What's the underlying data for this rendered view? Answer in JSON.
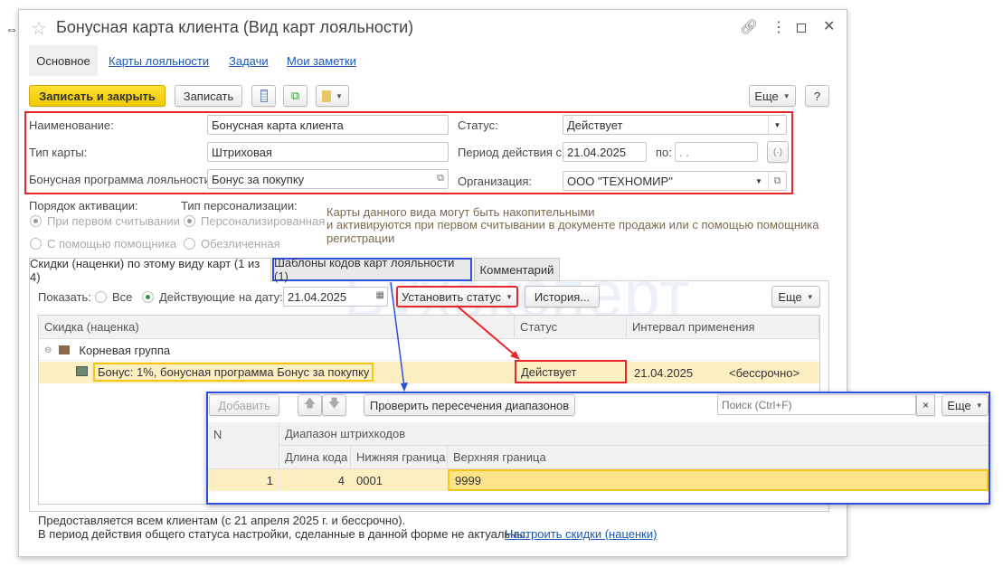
{
  "window": {
    "title": "Бонусная карта клиента (Вид карт лояльности)"
  },
  "nav": {
    "tabs": [
      {
        "label": "Основное"
      },
      {
        "label": "Карты лояльности"
      },
      {
        "label": "Задачи"
      },
      {
        "label": "Мои заметки"
      }
    ]
  },
  "toolbar": {
    "save_close": "Записать и закрыть",
    "save": "Записать",
    "more": "Еще",
    "help": "?"
  },
  "form": {
    "name_label": "Наименование:",
    "name_value": "Бонусная карта клиента",
    "type_label": "Тип карты:",
    "type_value": "Штриховая",
    "program_label": "Бонусная программа лояльности:",
    "program_value": "Бонус за покупку",
    "status_label": "Статус:",
    "status_value": "Действует",
    "period_label": "Период действия с:",
    "period_from": "21.04.2025",
    "period_to_label": "по:",
    "period_to": " .  .",
    "org_label": "Организация:",
    "org_value": "ООО \"ТЕХНОМИР\""
  },
  "activation": {
    "label": "Порядок активации:",
    "options": [
      "При первом считывании",
      "С помощью помощника"
    ]
  },
  "personalization": {
    "label": "Тип персонализации:",
    "options": [
      "Персонализированная",
      "Обезличенная"
    ]
  },
  "info": [
    "Карты данного вида могут быть накопительными",
    "и активируются при первом считывании в документе продажи или с помощью помощника",
    "регистрации"
  ],
  "watermark": "Бухэксперт",
  "subtabs": [
    {
      "label": "Скидки (наценки) по этому виду карт (1 из 4)"
    },
    {
      "label": "Шаблоны кодов карт лояльности (1)"
    },
    {
      "label": "Комментарий"
    }
  ],
  "filter": {
    "show_label": "Показать:",
    "all": "Все",
    "active": "Действующие",
    "date_label": "на дату:",
    "date": "21.04.2025",
    "set_status": "Установить статус",
    "history": "История...",
    "more": "Еще"
  },
  "discounts": {
    "columns": [
      "Скидка (наценка)",
      "Статус",
      "Интервал применения"
    ],
    "group": "Корневая группа",
    "rows": [
      {
        "name": "Бонус: 1%, бонусная программа Бонус за покупку",
        "status": "Действует",
        "from": "21.04.2025",
        "to": "<бессрочно>"
      }
    ]
  },
  "templates": {
    "add": "Добавить",
    "check": "Проверить пересечения диапазонов",
    "search_placeholder": "Поиск (Ctrl+F)",
    "clear": "×",
    "more": "Еще",
    "columns": {
      "n": "N",
      "range": "Диапазон штрихкодов",
      "length": "Длина кода",
      "lower": "Нижняя граница",
      "upper": "Верхняя граница"
    },
    "rows": [
      {
        "n": "1",
        "length": "4",
        "lower": "0001",
        "upper": "9999"
      }
    ]
  },
  "footer": {
    "line1": "Предоставляется всем клиентам (с 21 апреля 2025 г. и бессрочно).",
    "line2": "В период действия общего статуса настройки, сделанные в данной форме не актуальны.",
    "link": "Настроить скидки (наценки)"
  },
  "colors": {
    "accent_yellow": "#f5d400",
    "highlight_red": "#e8262b",
    "highlight_blue": "#2d4fe0",
    "row_highlight": "#fcefc2"
  }
}
